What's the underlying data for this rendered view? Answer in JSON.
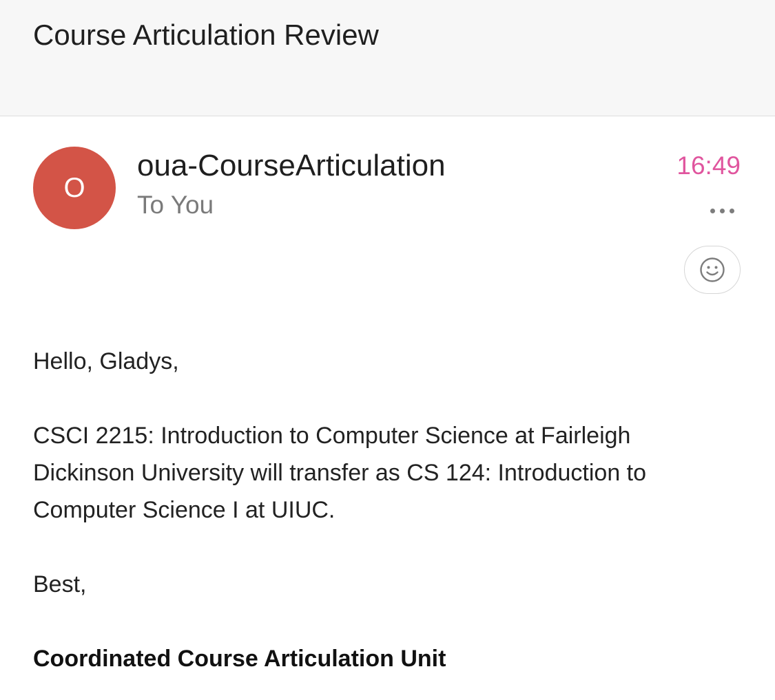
{
  "header": {
    "subject": "Course Articulation Review"
  },
  "message": {
    "avatar_letter": "O",
    "sender": "oua-CourseArticulation",
    "recipient": "To You",
    "time": "16:49",
    "more_icon": "more-horizontal-icon",
    "reaction_icon": "smiley-icon",
    "greeting": "Hello, Gladys,",
    "body": "CSCI 2215: Introduction to Computer Science at Fairleigh Dickinson University will transfer as CS 124: Introduction to Computer Science I at UIUC.",
    "closing": "Best,",
    "signature": "Coordinated Course Articulation Unit"
  },
  "colors": {
    "avatar_bg": "#d35447",
    "time_accent": "#e0559e",
    "header_bg": "#f7f7f7"
  }
}
